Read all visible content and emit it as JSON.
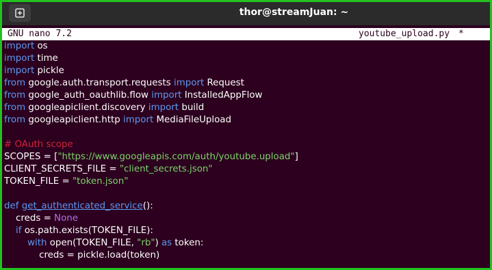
{
  "window": {
    "title": "thor@streamJuan: ~",
    "new_tab_icon": "new-tab-icon"
  },
  "nano": {
    "version": "GNU nano 7.2",
    "filename": "youtube_upload.py",
    "modified_marker": "*"
  },
  "colors": {
    "frame_border": "#22c21f",
    "terminal_bg": "#2c001e",
    "keyword": "#5e99f2",
    "string": "#7dd36b",
    "comment": "#d2243a",
    "constant": "#b470e6",
    "text": "#ffffff"
  },
  "code_lines": [
    [
      {
        "t": "import",
        "c": "kw"
      },
      {
        "t": " os",
        "c": "plain"
      }
    ],
    [
      {
        "t": "import",
        "c": "kw"
      },
      {
        "t": " time",
        "c": "plain"
      }
    ],
    [
      {
        "t": "import",
        "c": "kw"
      },
      {
        "t": " pickle",
        "c": "plain"
      }
    ],
    [
      {
        "t": "from",
        "c": "kw"
      },
      {
        "t": " google.auth.transport.requests ",
        "c": "plain"
      },
      {
        "t": "import",
        "c": "kw"
      },
      {
        "t": " Request",
        "c": "plain"
      }
    ],
    [
      {
        "t": "from",
        "c": "kw"
      },
      {
        "t": " google_auth_oauthlib.flow ",
        "c": "plain"
      },
      {
        "t": "import",
        "c": "kw"
      },
      {
        "t": " InstalledAppFlow",
        "c": "plain"
      }
    ],
    [
      {
        "t": "from",
        "c": "kw"
      },
      {
        "t": " googleapiclient.discovery ",
        "c": "plain"
      },
      {
        "t": "import",
        "c": "kw"
      },
      {
        "t": " build",
        "c": "plain"
      }
    ],
    [
      {
        "t": "from",
        "c": "kw"
      },
      {
        "t": " googleapiclient.http ",
        "c": "plain"
      },
      {
        "t": "import",
        "c": "kw"
      },
      {
        "t": " MediaFileUpload",
        "c": "plain"
      }
    ],
    [],
    [
      {
        "t": "# OAuth scope",
        "c": "cmt"
      }
    ],
    [
      {
        "t": "SCOPES = [",
        "c": "plain"
      },
      {
        "t": "\"https://www.googleapis.com/auth/youtube.upload\"",
        "c": "str"
      },
      {
        "t": "]",
        "c": "plain"
      }
    ],
    [
      {
        "t": "CLIENT_SECRETS_FILE = ",
        "c": "plain"
      },
      {
        "t": "\"client_secrets.json\"",
        "c": "str"
      }
    ],
    [
      {
        "t": "TOKEN_FILE = ",
        "c": "plain"
      },
      {
        "t": "\"token.json\"",
        "c": "str"
      }
    ],
    [],
    [
      {
        "t": "def",
        "c": "kw"
      },
      {
        "t": " ",
        "c": "plain"
      },
      {
        "t": "get_authenticated_service",
        "c": "fn"
      },
      {
        "t": "():",
        "c": "plain"
      }
    ],
    [
      {
        "t": "    creds = ",
        "c": "plain"
      },
      {
        "t": "None",
        "c": "cls"
      }
    ],
    [
      {
        "t": "    ",
        "c": "plain"
      },
      {
        "t": "if",
        "c": "kw"
      },
      {
        "t": " os.path.exists(TOKEN_FILE):",
        "c": "plain"
      }
    ],
    [
      {
        "t": "        ",
        "c": "plain"
      },
      {
        "t": "with",
        "c": "kw"
      },
      {
        "t": " open(TOKEN_FILE, ",
        "c": "plain"
      },
      {
        "t": "\"rb\"",
        "c": "str"
      },
      {
        "t": ") ",
        "c": "plain"
      },
      {
        "t": "as",
        "c": "kw"
      },
      {
        "t": " token:",
        "c": "plain"
      }
    ],
    [
      {
        "t": "            creds = pickle.load(token)",
        "c": "plain"
      }
    ]
  ]
}
